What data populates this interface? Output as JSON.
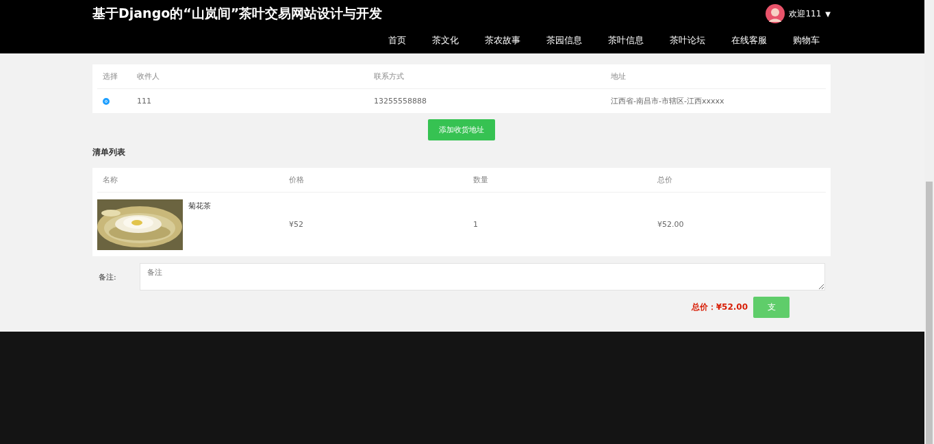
{
  "header": {
    "title": "基于Django的“山岚间”茶叶交易网站设计与开发",
    "user": {
      "greeting": "欢迎111",
      "caret": "▼"
    },
    "nav": [
      {
        "label": "首页"
      },
      {
        "label": "茶文化"
      },
      {
        "label": "茶农故事"
      },
      {
        "label": "茶园信息"
      },
      {
        "label": "茶叶信息"
      },
      {
        "label": "茶叶论坛"
      },
      {
        "label": "在线客服"
      },
      {
        "label": "购物车"
      }
    ]
  },
  "address_table": {
    "columns": [
      "选择",
      "收件人",
      "联系方式",
      "地址"
    ],
    "rows": [
      {
        "selected": true,
        "recipient": "111",
        "phone": "13255558888",
        "address": "江西省-南昌市-市辖区-江西xxxxx"
      }
    ]
  },
  "add_address_button": "添加收货地址",
  "list_title": "清单列表",
  "items_table": {
    "columns": [
      "名称",
      "价格",
      "数量",
      "总价"
    ],
    "rows": [
      {
        "name": "菊花茶",
        "price": "¥52",
        "quantity": "1",
        "total": "¥52.00"
      }
    ]
  },
  "remark": {
    "label": "备注:",
    "placeholder": "备注"
  },
  "total": {
    "label": "总价：",
    "value": "¥52.00"
  },
  "pay_button": "支"
}
